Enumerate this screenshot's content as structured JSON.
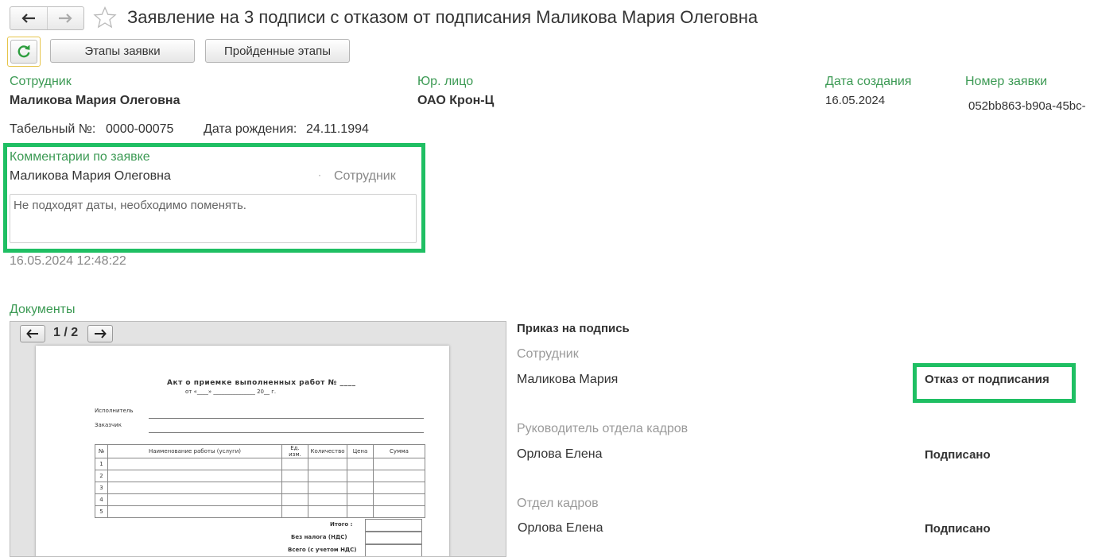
{
  "header": {
    "title": "Заявление на 3 подписи с отказом от подписания Маликова Мария Олеговна"
  },
  "toolbar": {
    "stages_label": "Этапы заявки",
    "passed_stages_label": "Пройденные этапы"
  },
  "info": {
    "employee_label": "Сотрудник",
    "employee_value": "Маликова Мария Олеговна",
    "legal_label": "Юр. лицо",
    "legal_value": "ОАО Крон-Ц",
    "created_label": "Дата создания",
    "created_value": "16.05.2024",
    "number_label": "Номер заявки",
    "number_value": "052bb863-b90a-45bc-",
    "tab_label": "Табельный №:",
    "tab_value": "0000-00075",
    "birth_label": "Дата рождения:",
    "birth_value": "24.11.1994"
  },
  "comments": {
    "label": "Комментарии по заявке",
    "author": "Маликова Мария Олеговна",
    "separator": "·",
    "role": "Сотрудник",
    "text": "Не подходят даты, необходимо поменять.",
    "timestamp": "16.05.2024 12:48:22"
  },
  "documents": {
    "label": "Документы",
    "page_indicator": "1 / 2",
    "doc_title": "Акт о приемке выполненных работ № ____",
    "doc_date": "от «____» _______________ 20__ г.",
    "executor_label": "Исполнитель",
    "customer_label": "Заказчик",
    "table_headers": [
      "№",
      "Наименование работы (услуги)",
      "Ед. изм.",
      "Количество",
      "Цена",
      "Сумма"
    ],
    "row_numbers": [
      "1",
      "2",
      "3",
      "4",
      "5"
    ],
    "total_labels": [
      "Итого :",
      "Без налога (НДС)",
      "Всего (с учетом НДС)"
    ]
  },
  "signing": {
    "heading": "Приказ на подпись",
    "roles": [
      {
        "role": "Сотрудник",
        "name": "Маликова Мария",
        "status": "Отказ от подписания"
      },
      {
        "role": "Руководитель отдела кадров",
        "name": "Орлова Елена",
        "status": "Подписано"
      },
      {
        "role": "Отдел кадров",
        "name": "Орлова Елена",
        "status": "Подписано"
      }
    ]
  },
  "colors": {
    "accent_green": "#3c9a54",
    "highlight_green": "#1fbf63",
    "refresh_border": "#e6c44a"
  }
}
